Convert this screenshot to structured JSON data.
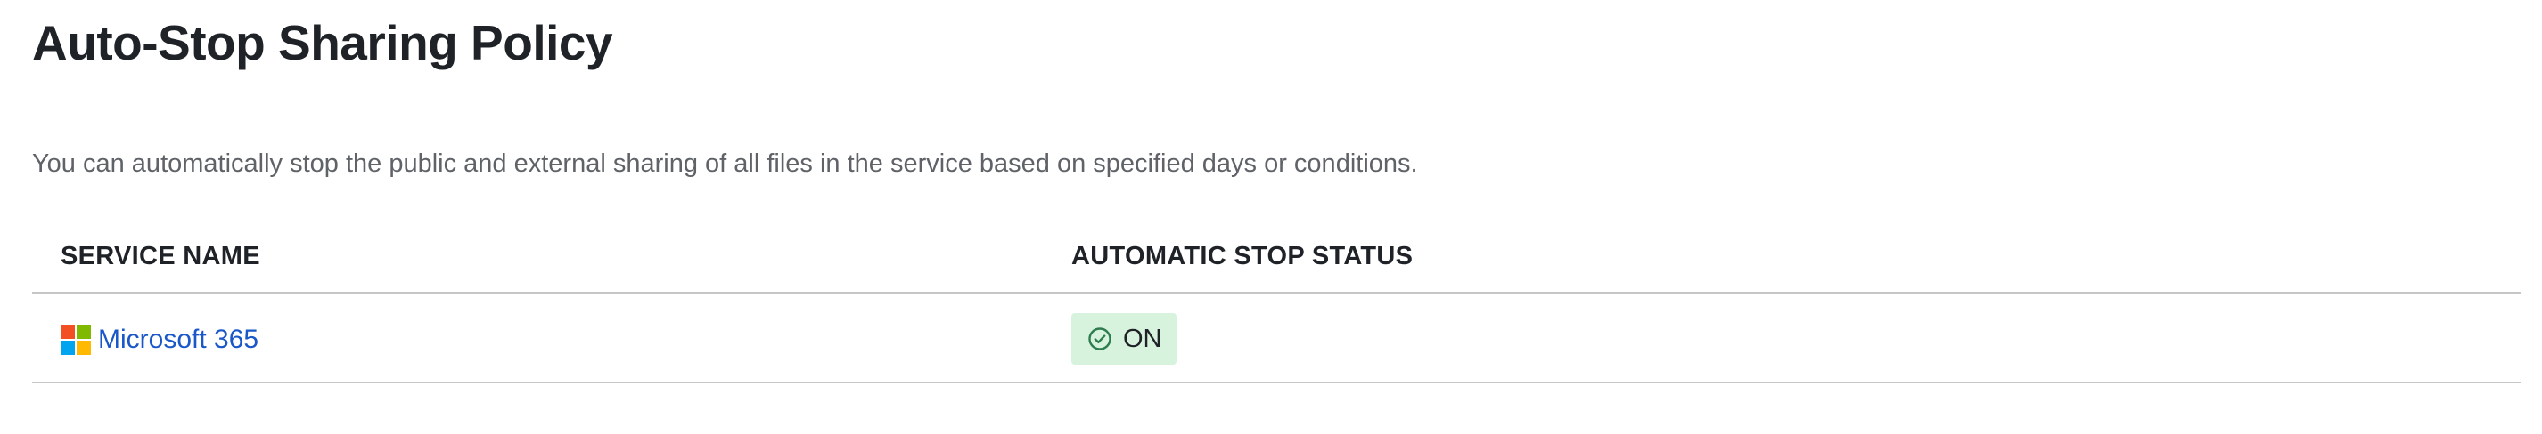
{
  "page": {
    "title": "Auto-Stop Sharing Policy",
    "description": "You can automatically stop the public and external sharing of all files in the service based on specified days or conditions."
  },
  "table": {
    "columns": [
      "SERVICE NAME",
      "AUTOMATIC STOP STATUS"
    ],
    "rows": [
      {
        "service_name": "Microsoft 365",
        "service_icon": "microsoft-logo-icon",
        "status": "ON",
        "status_icon": "check-circle-icon"
      }
    ]
  },
  "colors": {
    "link": "#1a57c9",
    "status_on_bg": "#d7f2dd",
    "status_on_icon": "#2e7d4f",
    "ms_red": "#f25022",
    "ms_green": "#7fba00",
    "ms_blue": "#00a4ef",
    "ms_yellow": "#ffb900"
  }
}
